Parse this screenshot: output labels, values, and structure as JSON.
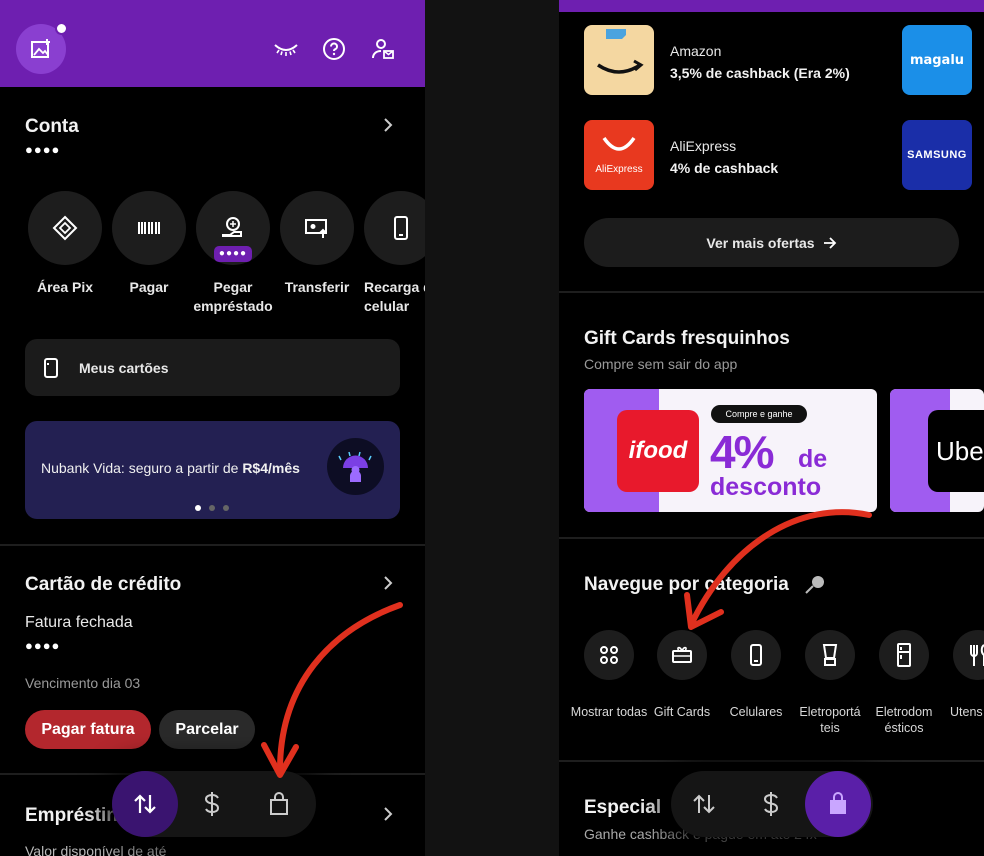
{
  "left": {
    "account": {
      "title": "Conta",
      "balance_masked": "●●●●"
    },
    "actions": [
      {
        "label": "Área Pix",
        "icon": "pix-icon"
      },
      {
        "label": "Pagar",
        "icon": "barcode-icon"
      },
      {
        "label": "Pegar empréstado",
        "icon": "loan-icon",
        "badge": "●●●●"
      },
      {
        "label": "Transferir",
        "icon": "transfer-icon"
      },
      {
        "label": "Recarga d celular",
        "icon": "phone-icon"
      }
    ],
    "my_cards": "Meus cartões",
    "promo": {
      "text": "Nubank Vida: seguro a partir de ",
      "highlight": "R$4/mês"
    },
    "credit": {
      "title": "Cartão de crédito",
      "status": "Fatura fechada",
      "amount_masked": "●●●●",
      "due": "Vencimento dia 03",
      "pay_button": "Pagar fatura",
      "split_button": "Parcelar"
    },
    "loans_title": "Empréstin",
    "loans_sub": "Valor disponível de até"
  },
  "right": {
    "stores": [
      {
        "name": "Amazon",
        "cashback": "3,5% de cashback (Era 2%)"
      },
      {
        "name": "AliExpress",
        "cashback": "4% de cashback",
        "logo_text": "AliExpress"
      }
    ],
    "side_logos": [
      "magalu",
      "SAMSUNG"
    ],
    "more_offers": "Ver mais ofertas",
    "gift_cards": {
      "title": "Gift Cards fresquinhos",
      "subtitle": "Compre sem sair do app",
      "ifood_logo": "ifood",
      "tag": "Compre e ganhe",
      "discount_big": "4%",
      "discount_de": "de",
      "discount_word": "desconto",
      "uber_text": "Ube"
    },
    "categories": {
      "title": "Navegue por categoria",
      "items": [
        {
          "label": "Mostrar todas",
          "icon": "grid-icon"
        },
        {
          "label": "Gift Cards",
          "icon": "gift-card-icon"
        },
        {
          "label": "Celulares",
          "icon": "phone-icon"
        },
        {
          "label": "Eletroportá teis",
          "icon": "blender-icon"
        },
        {
          "label": "Eletrodom ésticos",
          "icon": "fridge-icon"
        },
        {
          "label": "Utens",
          "icon": "utensils-icon"
        }
      ]
    },
    "special_title": "Especial",
    "special_sub": "Ganhe cashback e pague em até 24x"
  },
  "colors": {
    "brand_purple": "#6e1fb0",
    "danger_red": "#b3272d",
    "annotation_red": "#e0301e"
  }
}
